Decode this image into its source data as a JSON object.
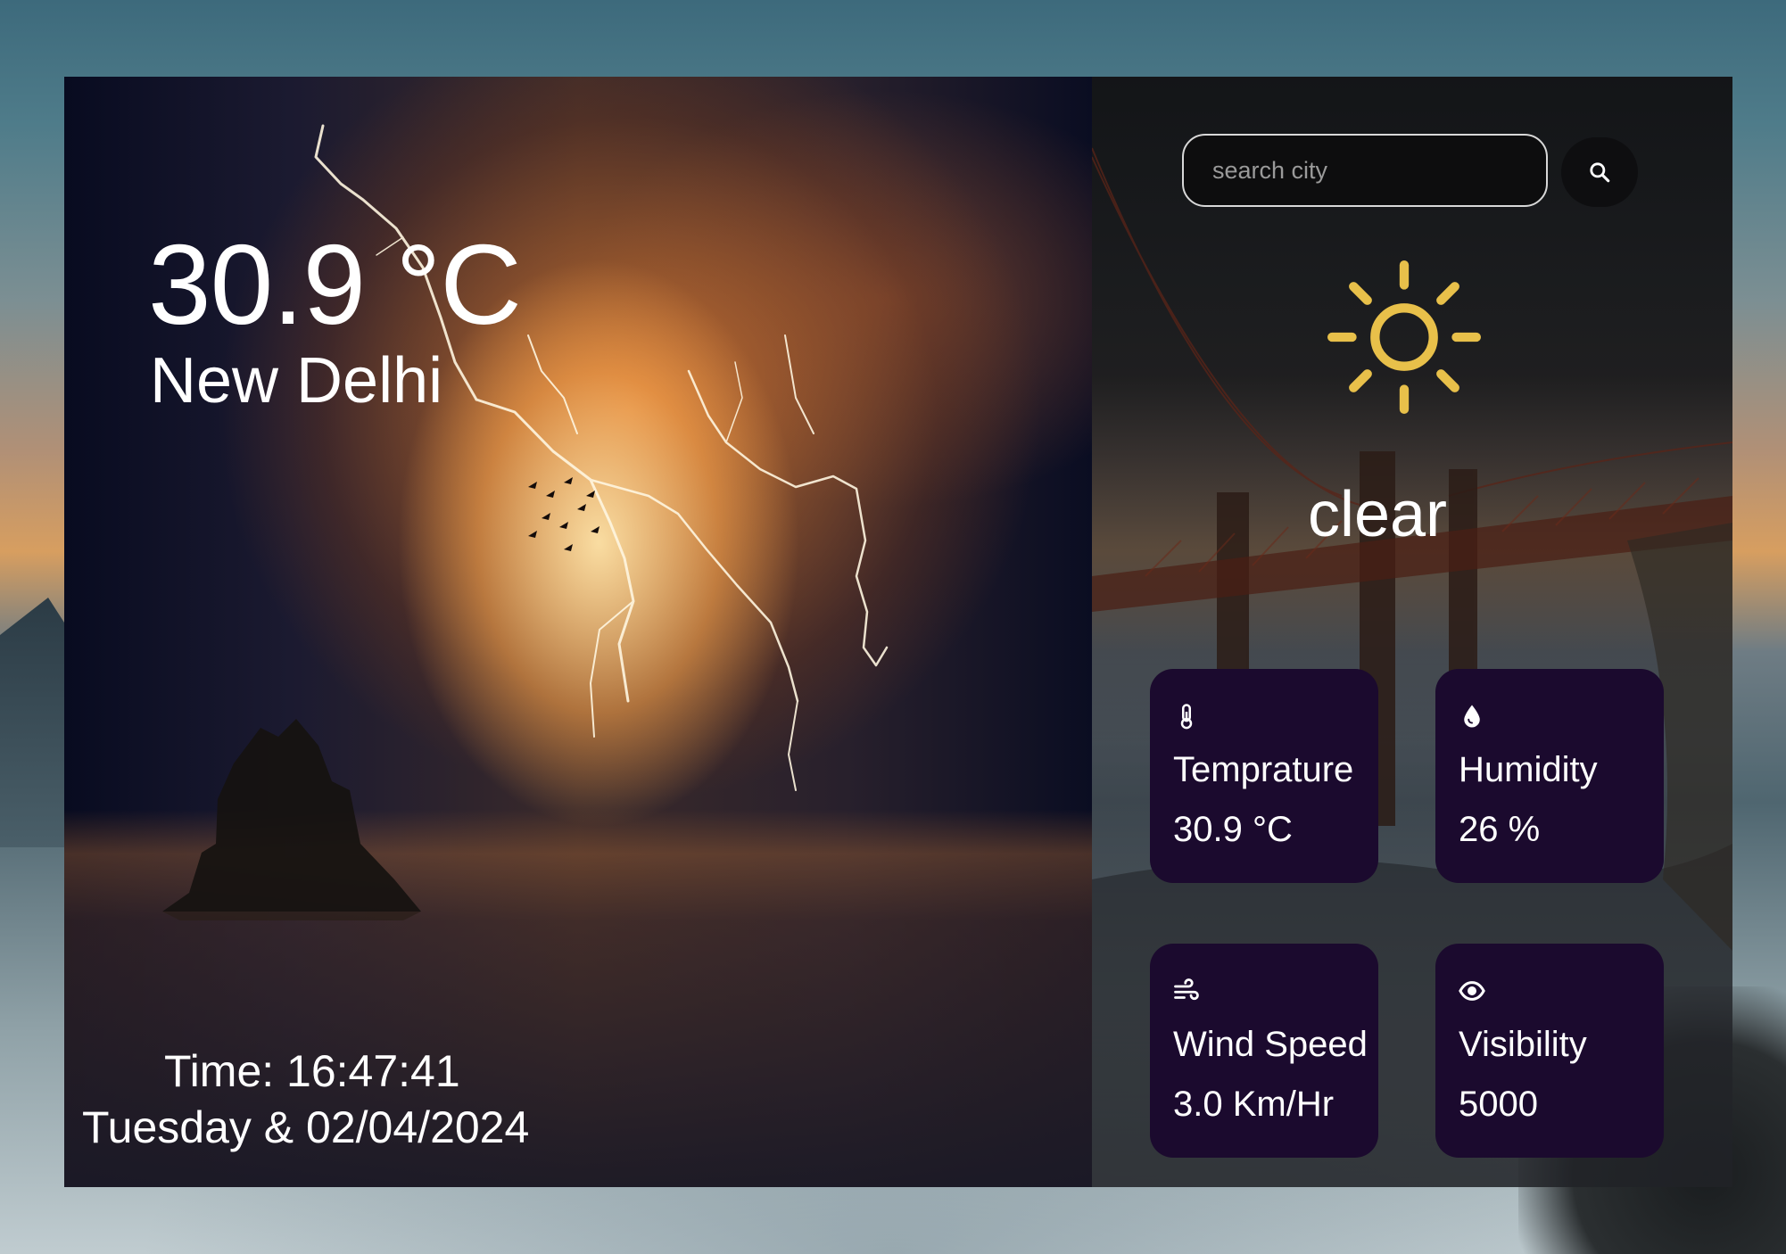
{
  "current": {
    "temperature": "30.9 °C",
    "city": "New Delhi",
    "time": "Time: 16:47:41",
    "date": "Tuesday & 02/04/2024"
  },
  "search": {
    "placeholder": "search city",
    "value": ""
  },
  "condition": {
    "label": "clear",
    "icon": "sun-icon",
    "icon_color": "#e8c04a"
  },
  "cards": [
    {
      "icon": "thermometer-icon",
      "label": "Temprature",
      "value": "30.9 °C"
    },
    {
      "icon": "water-drop-icon",
      "label": "Humidity",
      "value": "26 %"
    },
    {
      "icon": "wind-icon",
      "label": "Wind Speed",
      "value": "3.0 Km/Hr"
    },
    {
      "icon": "eye-icon",
      "label": "Visibility",
      "value": "5000"
    }
  ],
  "colors": {
    "card_background": "#1b0a2e",
    "text": "#ffffff",
    "search_border": "#d8d8d8"
  }
}
